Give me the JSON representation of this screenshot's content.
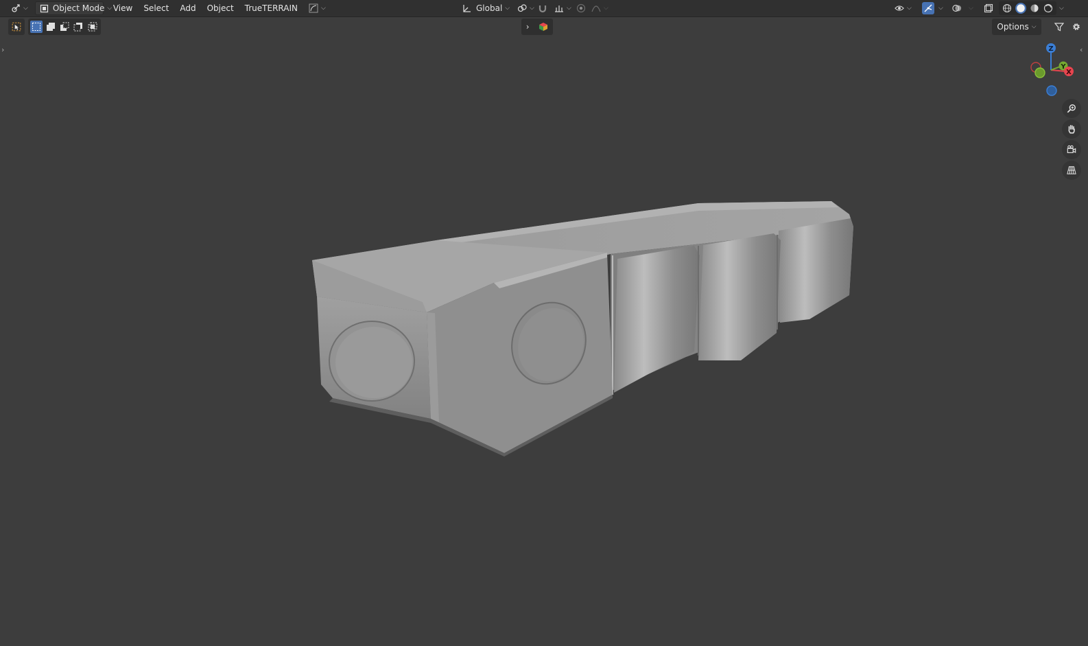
{
  "header": {
    "editor_type_icon": "editor-type-3d-viewport-icon",
    "mode": {
      "icon": "object-mode-icon",
      "label": "Object Mode"
    },
    "menus": [
      "View",
      "Select",
      "Add",
      "Object",
      "TrueTERRAIN"
    ],
    "transform_orientation": {
      "icon": "transform-orientation-icon",
      "label": "Global"
    },
    "pivot_icon": "pivot-point-icon",
    "snap_icon": "snap-magnet-icon",
    "snap_target_icon": "snap-increment-icon",
    "proportional_icon": "proportional-editing-icon",
    "falloff_icon": "falloff-curve-icon",
    "visibility_icon": "visibility-eye-icon",
    "gizmo_icon": "gizmo-toggle-icon",
    "overlay_icon": "overlay-icon",
    "xray_icon": "xray-icon",
    "shading_modes": [
      "wireframe",
      "solid",
      "material-preview",
      "rendered"
    ],
    "active_shading": "solid"
  },
  "toolbar": {
    "select_tool_icon": "select-box-tool-icon",
    "selection_modes": [
      "new-selection",
      "extend-selection",
      "subtract-selection",
      "invert-selection"
    ],
    "active_selection_mode": "new-selection",
    "options_label": "Options",
    "filter_icon": "filter-icon",
    "settings_icon": "gear-icon"
  },
  "navigation_gizmo": {
    "axes": [
      "Z",
      "Y",
      "X"
    ],
    "colors": {
      "x": "#e8454f",
      "y": "#77ac32",
      "z": "#3b7fd6"
    }
  },
  "nav_buttons": [
    "zoom-icon",
    "pan-hand-icon",
    "camera-view-icon",
    "perspective-grid-icon"
  ],
  "colors": {
    "viewport_bg": "#3d3d3d",
    "header_bg": "#303030",
    "accent": "#4772b3"
  }
}
